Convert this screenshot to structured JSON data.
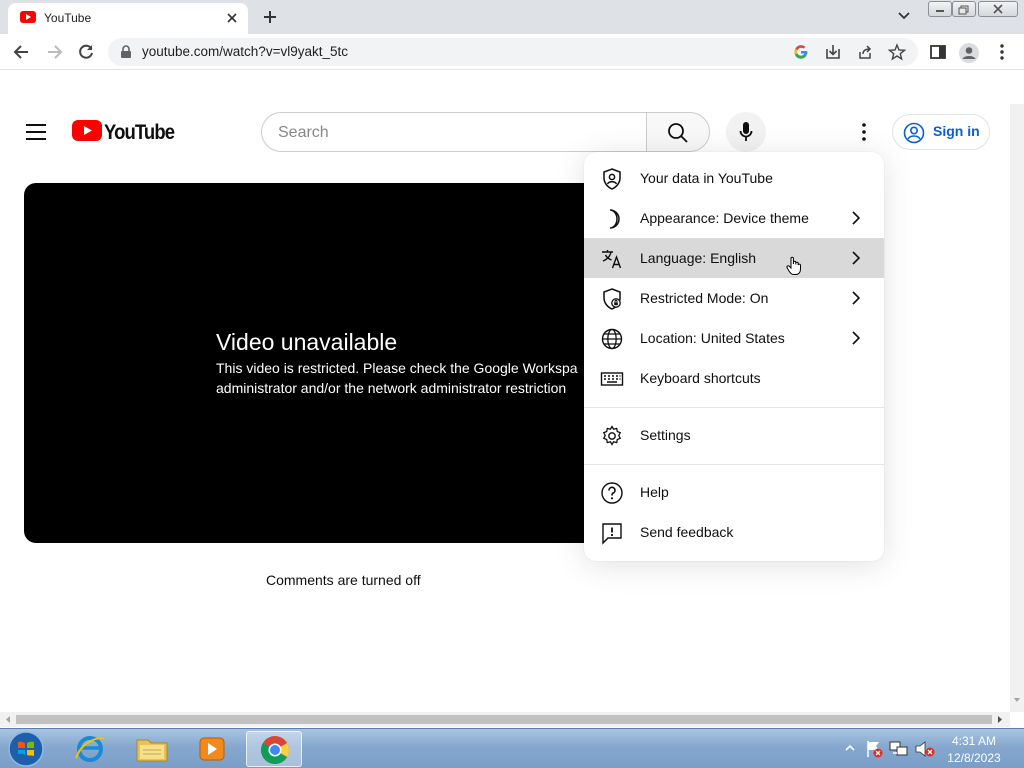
{
  "browser": {
    "tab_title": "YouTube",
    "url": "youtube.com/watch?v=vl9yakt_5tc"
  },
  "youtube": {
    "logo_text": "YouTube",
    "search_placeholder": "Search",
    "signin_label": "Sign in",
    "brand_color": "#ff0000",
    "link_color": "#065fd4"
  },
  "player": {
    "error_title": "Video unavailable",
    "error_line1": "This video is restricted. Please check the Google Workspa",
    "error_line2": "administrator and/or the network administrator restriction"
  },
  "comments_status": "Comments are turned off",
  "menu": {
    "items": [
      {
        "label": "Your data in YouTube",
        "icon": "shield-person-icon",
        "submenu": false
      },
      {
        "label": "Appearance: Device theme",
        "icon": "moon-icon",
        "submenu": true
      },
      {
        "label": "Language: English",
        "icon": "translate-icon",
        "submenu": true,
        "highlighted": true
      },
      {
        "label": "Restricted Mode: On",
        "icon": "shield-lock-icon",
        "submenu": true
      },
      {
        "label": "Location: United States",
        "icon": "globe-icon",
        "submenu": true
      },
      {
        "label": "Keyboard shortcuts",
        "icon": "keyboard-icon",
        "submenu": false
      },
      {
        "label": "Settings",
        "icon": "gear-icon",
        "submenu": false
      },
      {
        "label": "Help",
        "icon": "help-icon",
        "submenu": false
      },
      {
        "label": "Send feedback",
        "icon": "feedback-icon",
        "submenu": false
      }
    ]
  },
  "taskbar": {
    "time": "4:31 AM",
    "date": "12/8/2023"
  }
}
